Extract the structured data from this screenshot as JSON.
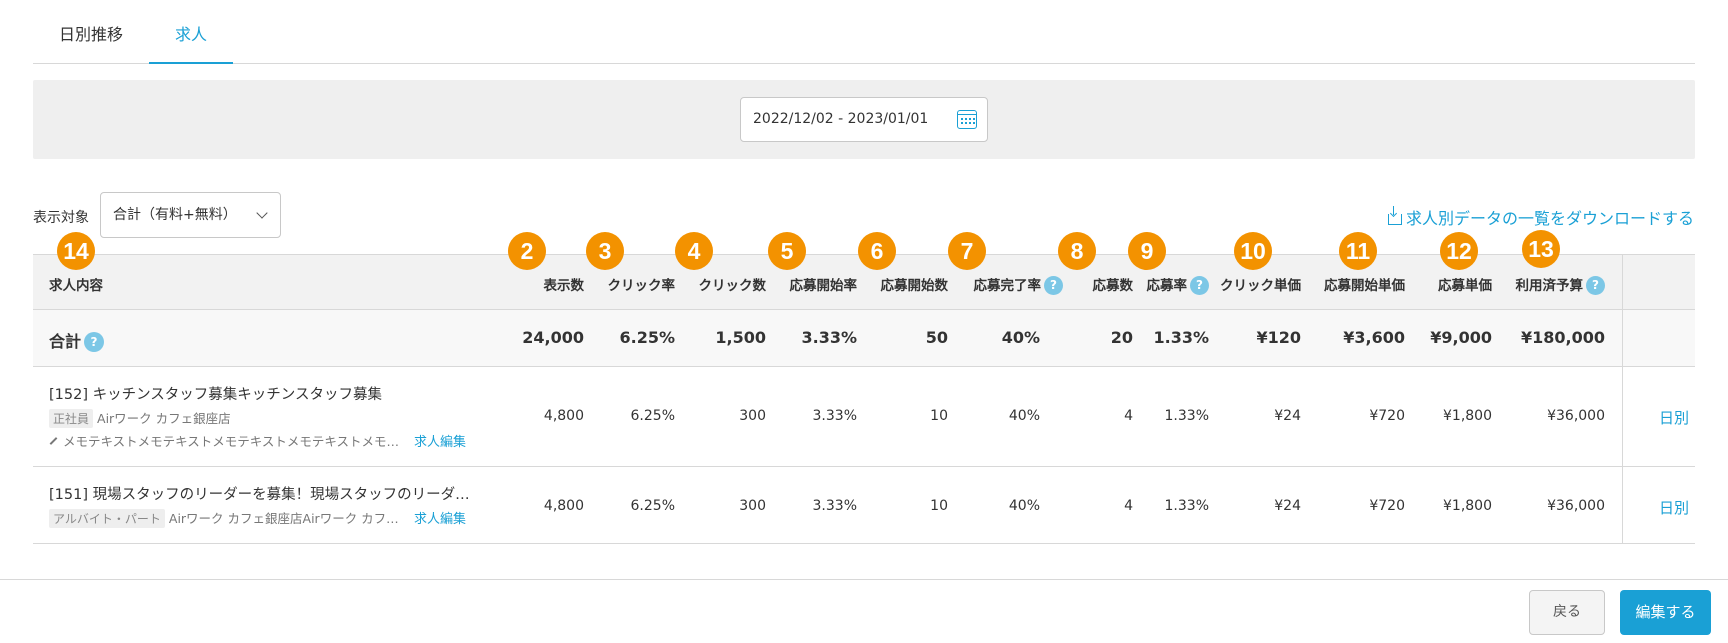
{
  "tabs": [
    "日別推移",
    "求人"
  ],
  "date_range": "2022/12/02 - 2023/01/01",
  "filter": {
    "label": "表示対象",
    "selected": "合計（有料+無料）"
  },
  "download_label": "求人別データの一覧をダウンロードする",
  "badges": [
    "14",
    "2",
    "3",
    "4",
    "5",
    "6",
    "7",
    "8",
    "9",
    "10",
    "11",
    "12",
    "13"
  ],
  "columns": [
    "求人内容",
    "表示数",
    "クリック率",
    "クリック数",
    "応募開始率",
    "応募開始数",
    "応募完了率",
    "応募数",
    "応募率",
    "クリック単価",
    "応募開始単価",
    "応募単価",
    "利用済予算"
  ],
  "help_mark": "?",
  "total": {
    "label": "合計",
    "values": [
      "24,000",
      "6.25%",
      "1,500",
      "3.33%",
      "50",
      "40%",
      "20",
      "1.33%",
      "¥120",
      "¥3,600",
      "¥9,000",
      "¥180,000"
    ]
  },
  "rows": [
    {
      "title": "[152] キッチンスタッフ募集キッチンスタッフ募集",
      "tag": "正社員",
      "store": "Airワーク カフェ銀座店",
      "memo": "メモテキストメモテキストメモテキストメモテキストメモ…",
      "edit": "求人編集",
      "values": [
        "4,800",
        "6.25%",
        "300",
        "3.33%",
        "10",
        "40%",
        "4",
        "1.33%",
        "¥24",
        "¥720",
        "¥1,800",
        "¥36,000"
      ],
      "daily": "日別"
    },
    {
      "title": "[151] 現場スタッフのリーダーを募集！現場スタッフのリーダ…",
      "tag": "アルバイト・パート",
      "store": "Airワーク カフェ銀座店Airワーク カフ…",
      "edit": "求人編集",
      "values": [
        "4,800",
        "6.25%",
        "300",
        "3.33%",
        "10",
        "40%",
        "4",
        "1.33%",
        "¥24",
        "¥720",
        "¥1,800",
        "¥36,000"
      ],
      "daily": "日別"
    }
  ],
  "footer": {
    "back": "戻る",
    "edit": "編集する"
  },
  "colors": {
    "accent": "#1aa0d5",
    "badge": "#f39200",
    "help": "#7cc7e6"
  }
}
